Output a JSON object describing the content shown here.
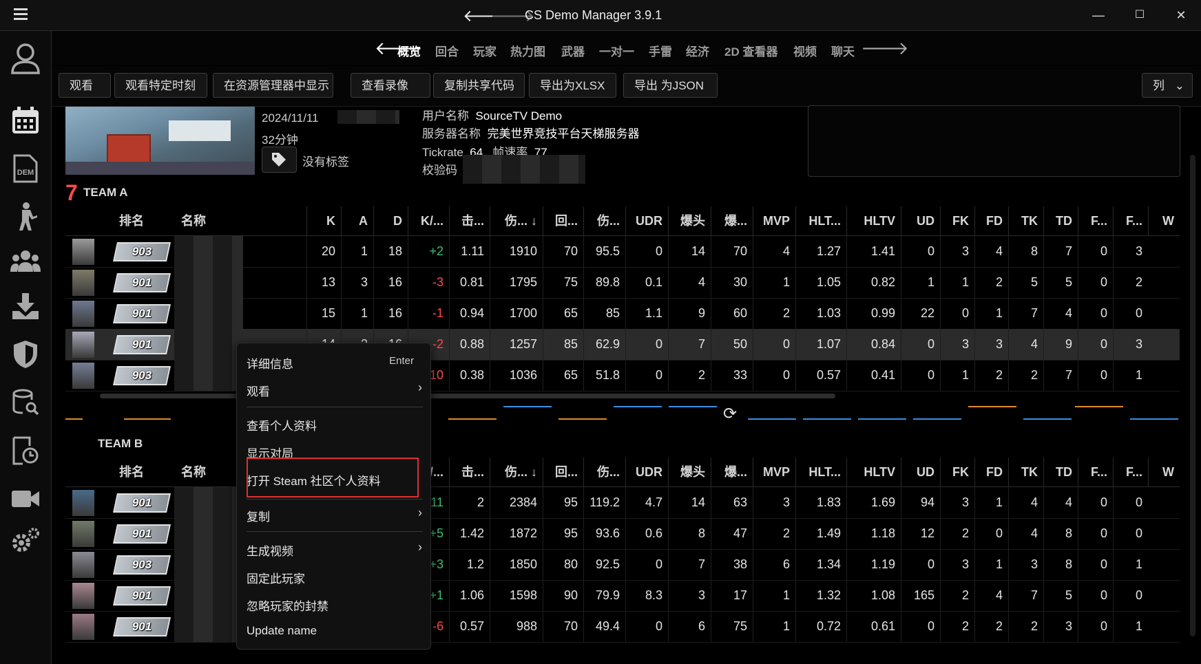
{
  "window": {
    "title": "CS Demo Manager 3.9.1",
    "minimize": "—",
    "maximize": "☐",
    "close": "✕"
  },
  "tabs": [
    "概览",
    "回合",
    "玩家",
    "热力图",
    "武器",
    "一对一",
    "手雷",
    "经济",
    "2D 查看器",
    "视频",
    "聊天"
  ],
  "toolbar": {
    "buttons": [
      "观看",
      "观看特定时刻",
      "在资源管理器中显示",
      "查看录像",
      "复制共享代码",
      "导出为XLSX",
      "导出 为JSON"
    ],
    "columns_label": "列"
  },
  "demo": {
    "date": "2024/11/11",
    "duration": "32分钟",
    "tags": "没有标签",
    "username_label": "用户名称",
    "username": "SourceTV Demo",
    "server_label": "服务器名称",
    "server": "完美世界竞技平台天梯服务器",
    "tickrate_label": "Tickrate",
    "tickrate": "64",
    "fps_label": "帧速率",
    "fps": "77",
    "checksum_label": "校验码"
  },
  "teamA": {
    "score": "7",
    "name": "TEAM A"
  },
  "teamB": {
    "name": "TEAM B"
  },
  "columns": [
    "排名",
    "名称",
    "K",
    "A",
    "D",
    "K/...",
    "击...",
    "伤... ↓",
    "回...",
    "伤...",
    "UDR",
    "爆头",
    "爆...",
    "MVP",
    "HLT...",
    "HLTV",
    "UD",
    "FK",
    "FD",
    "TK",
    "TD",
    "F...",
    "F...",
    "W"
  ],
  "teamA_rows": [
    {
      "rank": "903",
      "k": "20",
      "a": "1",
      "d": "18",
      "kd": "+2",
      "c1": "1.11",
      "dmg": "1910",
      "r": "70",
      "adr": "95.5",
      "udr": "0",
      "hs": "14",
      "hsp": "70",
      "mvp": "4",
      "h2": "1.27",
      "hltv": "1.41",
      "ud": "0",
      "fk": "3",
      "fd": "4",
      "tk": "8",
      "td": "7",
      "f1": "0",
      "f2": "3"
    },
    {
      "rank": "901",
      "k": "13",
      "a": "3",
      "d": "16",
      "kd": "-3",
      "c1": "0.81",
      "dmg": "1795",
      "r": "75",
      "adr": "89.8",
      "udr": "0.1",
      "hs": "4",
      "hsp": "30",
      "mvp": "1",
      "h2": "1.05",
      "hltv": "0.82",
      "ud": "1",
      "fk": "1",
      "fd": "2",
      "tk": "5",
      "td": "5",
      "f1": "0",
      "f2": "2"
    },
    {
      "rank": "901",
      "k": "15",
      "a": "1",
      "d": "16",
      "kd": "-1",
      "c1": "0.94",
      "dmg": "1700",
      "r": "65",
      "adr": "85",
      "udr": "1.1",
      "hs": "9",
      "hsp": "60",
      "mvp": "2",
      "h2": "1.03",
      "hltv": "0.99",
      "ud": "22",
      "fk": "0",
      "fd": "1",
      "tk": "7",
      "td": "4",
      "f1": "0",
      "f2": "0"
    },
    {
      "rank": "901",
      "k": "14",
      "a": "2",
      "d": "16",
      "kd": "-2",
      "c1": "0.88",
      "dmg": "1257",
      "r": "85",
      "adr": "62.9",
      "udr": "0",
      "hs": "7",
      "hsp": "50",
      "mvp": "0",
      "h2": "1.07",
      "hltv": "0.84",
      "ud": "0",
      "fk": "3",
      "fd": "3",
      "tk": "4",
      "td": "9",
      "f1": "0",
      "f2": "3"
    },
    {
      "rank": "903",
      "k": "",
      "a": "",
      "d": "",
      "kd": "-10",
      "c1": "0.38",
      "dmg": "1036",
      "r": "65",
      "adr": "51.8",
      "udr": "0",
      "hs": "2",
      "hsp": "33",
      "mvp": "0",
      "h2": "0.57",
      "hltv": "0.41",
      "ud": "0",
      "fk": "1",
      "fd": "2",
      "tk": "2",
      "td": "7",
      "f1": "0",
      "f2": "1"
    }
  ],
  "teamB_rows": [
    {
      "rank": "901",
      "kd": "+11",
      "c1": "2",
      "dmg": "2384",
      "r": "95",
      "adr": "119.2",
      "udr": "4.7",
      "hs": "14",
      "hsp": "63",
      "mvp": "3",
      "h2": "1.83",
      "hltv": "1.69",
      "ud": "94",
      "fk": "3",
      "fd": "1",
      "tk": "4",
      "td": "4",
      "f1": "0",
      "f2": "0"
    },
    {
      "rank": "901",
      "kd": "+5",
      "c1": "1.42",
      "dmg": "1872",
      "r": "95",
      "adr": "93.6",
      "udr": "0.6",
      "hs": "8",
      "hsp": "47",
      "mvp": "2",
      "h2": "1.49",
      "hltv": "1.18",
      "ud": "12",
      "fk": "2",
      "fd": "0",
      "tk": "4",
      "td": "8",
      "f1": "0",
      "f2": "0"
    },
    {
      "rank": "903",
      "kd": "+3",
      "c1": "1.2",
      "dmg": "1850",
      "r": "80",
      "adr": "92.5",
      "udr": "0",
      "hs": "7",
      "hsp": "38",
      "mvp": "6",
      "h2": "1.34",
      "hltv": "1.19",
      "ud": "0",
      "fk": "3",
      "fd": "1",
      "tk": "3",
      "td": "8",
      "f1": "0",
      "f2": "1"
    },
    {
      "rank": "901",
      "kd": "+1",
      "c1": "1.06",
      "dmg": "1598",
      "r": "90",
      "adr": "79.9",
      "udr": "8.3",
      "hs": "3",
      "hsp": "17",
      "mvp": "1",
      "h2": "1.32",
      "hltv": "1.08",
      "ud": "165",
      "fk": "2",
      "fd": "4",
      "tk": "7",
      "td": "5",
      "f1": "0",
      "f2": "0"
    },
    {
      "rank": "901",
      "kd": "-6",
      "c1": "0.57",
      "dmg": "988",
      "r": "70",
      "adr": "49.4",
      "udr": "0",
      "hs": "6",
      "hsp": "75",
      "mvp": "1",
      "h2": "0.72",
      "hltv": "0.61",
      "ud": "0",
      "fk": "2",
      "fd": "2",
      "tk": "2",
      "td": "3",
      "f1": "0",
      "f2": "1"
    }
  ],
  "context_menu": {
    "details": "详细信息",
    "details_shortcut": "Enter",
    "watch": "观看",
    "view_profile": "查看个人资料",
    "show_matches": "显示对局",
    "open_steam": "打开 Steam 社区个人资料",
    "copy": "复制",
    "generate_video": "生成视频",
    "pin_player": "固定此玩家",
    "ignore_bans": "忽略玩家的封禁",
    "update_name": "Update name"
  },
  "colors": {
    "accent_red": "#ff4a4a",
    "positive": "#3bc26b",
    "highlight_box": "#e03030",
    "ct_blue": "#3a8ee6",
    "t_orange": "#e08a2a"
  }
}
